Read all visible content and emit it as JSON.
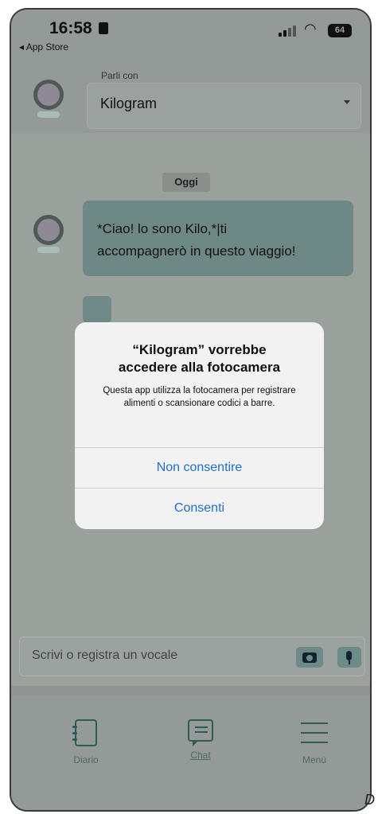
{
  "status_bar": {
    "time": "16:58",
    "back_app": "◂ App Store",
    "battery": "64"
  },
  "header": {
    "select_legend": "Parli con",
    "select_value": "Kilogram"
  },
  "chat": {
    "date_chip": "Oggi",
    "message_line1": "*Ciao! lo sono Kilo,*|ti",
    "message_line2": "accompagnerò in questo viaggio!"
  },
  "alert": {
    "title_line1": "“Kilogram” vorrebbe",
    "title_line2": "accedere alla fotocamera",
    "message": "Questa app utilizza la fotocamera per registrare alimenti o scansionare codici a barre.",
    "deny_label": "Non consentire",
    "allow_label": "Consenti"
  },
  "composer": {
    "placeholder": "Scrivi o registra un vocale",
    "camera_icon": "camera-icon",
    "mic_icon": "microphone-icon"
  },
  "bottom_nav": {
    "items": [
      {
        "label": "Diario",
        "icon": "diary-icon"
      },
      {
        "label": "Chat",
        "icon": "chat-icon"
      },
      {
        "label": "Menù",
        "icon": "menu-icon"
      }
    ],
    "active_item": "Chat"
  },
  "colors": {
    "accent": "#2d5b55",
    "link_blue": "#1f6fd6",
    "bubble": "#6e8985"
  },
  "corner_mark": "D"
}
